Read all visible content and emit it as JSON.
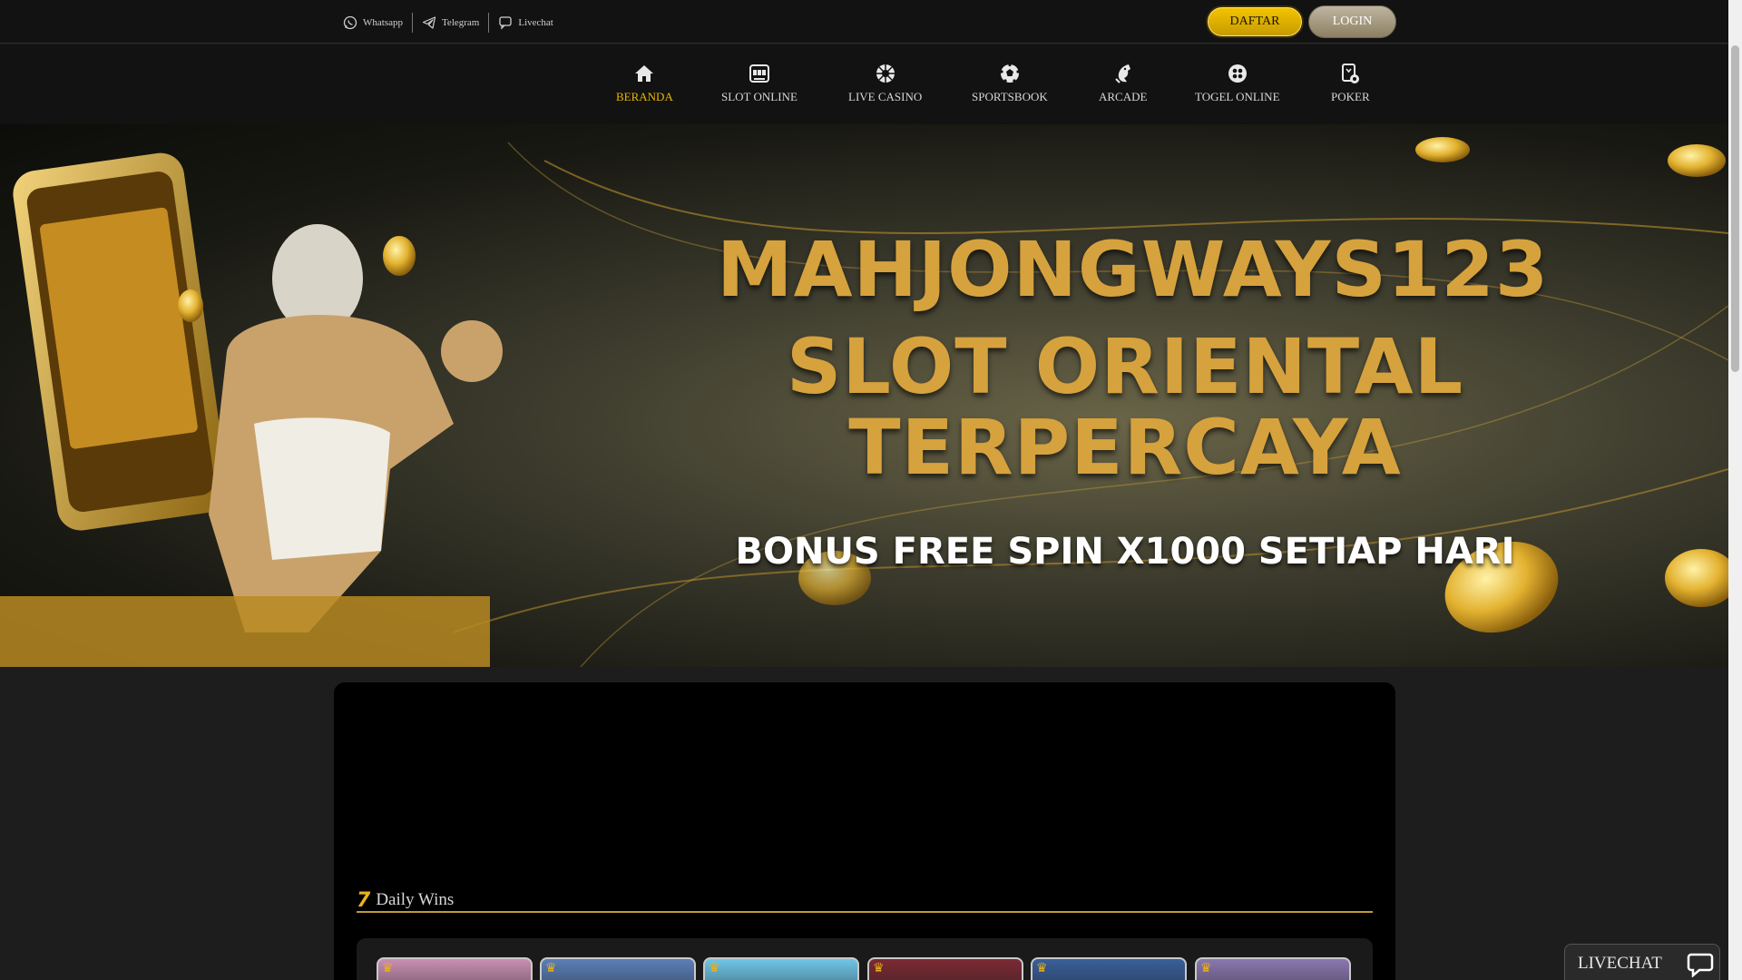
{
  "topbar": {
    "contacts": [
      {
        "label": "Whatsapp",
        "icon": "whatsapp-icon"
      },
      {
        "label": "Telegram",
        "icon": "telegram-icon"
      },
      {
        "label": "Livechat",
        "icon": "chat-bubble-icon"
      }
    ],
    "daftar_label": "DAFTAR",
    "login_label": "LOGIN"
  },
  "nav": {
    "items": [
      {
        "label": "BERANDA",
        "icon": "home-icon",
        "active": true
      },
      {
        "label": "SLOT ONLINE",
        "icon": "slot-machine-icon",
        "active": false
      },
      {
        "label": "LIVE CASINO",
        "icon": "roulette-icon",
        "active": false
      },
      {
        "label": "SPORTSBOOK",
        "icon": "soccer-ball-icon",
        "active": false
      },
      {
        "label": "ARCADE",
        "icon": "fish-icon",
        "active": false
      },
      {
        "label": "TOGEL ONLINE",
        "icon": "lottery-ball-icon",
        "active": false
      },
      {
        "label": "POKER",
        "icon": "poker-cards-icon",
        "active": false
      }
    ]
  },
  "banner": {
    "title_line1": "MAHJONGWAYS123",
    "title_line2": "SLOT ORIENTAL",
    "title_line3": "TERPERCAYA",
    "subtitle": "BONUS FREE SPIN X1000 SETIAP HARI"
  },
  "daily_wins": {
    "icon_text": "7",
    "title": "Daily Wins",
    "thumb_colors": [
      "#c98fb3",
      "#5b7fb8",
      "#6fc6e8",
      "#7a2a34",
      "#3a5f9a",
      "#8a78b0"
    ]
  },
  "livechat": {
    "label": "LIVECHAT"
  },
  "colors": {
    "accent": "#e8b500",
    "background": "#1d1d1d",
    "topbar": "#121212"
  }
}
